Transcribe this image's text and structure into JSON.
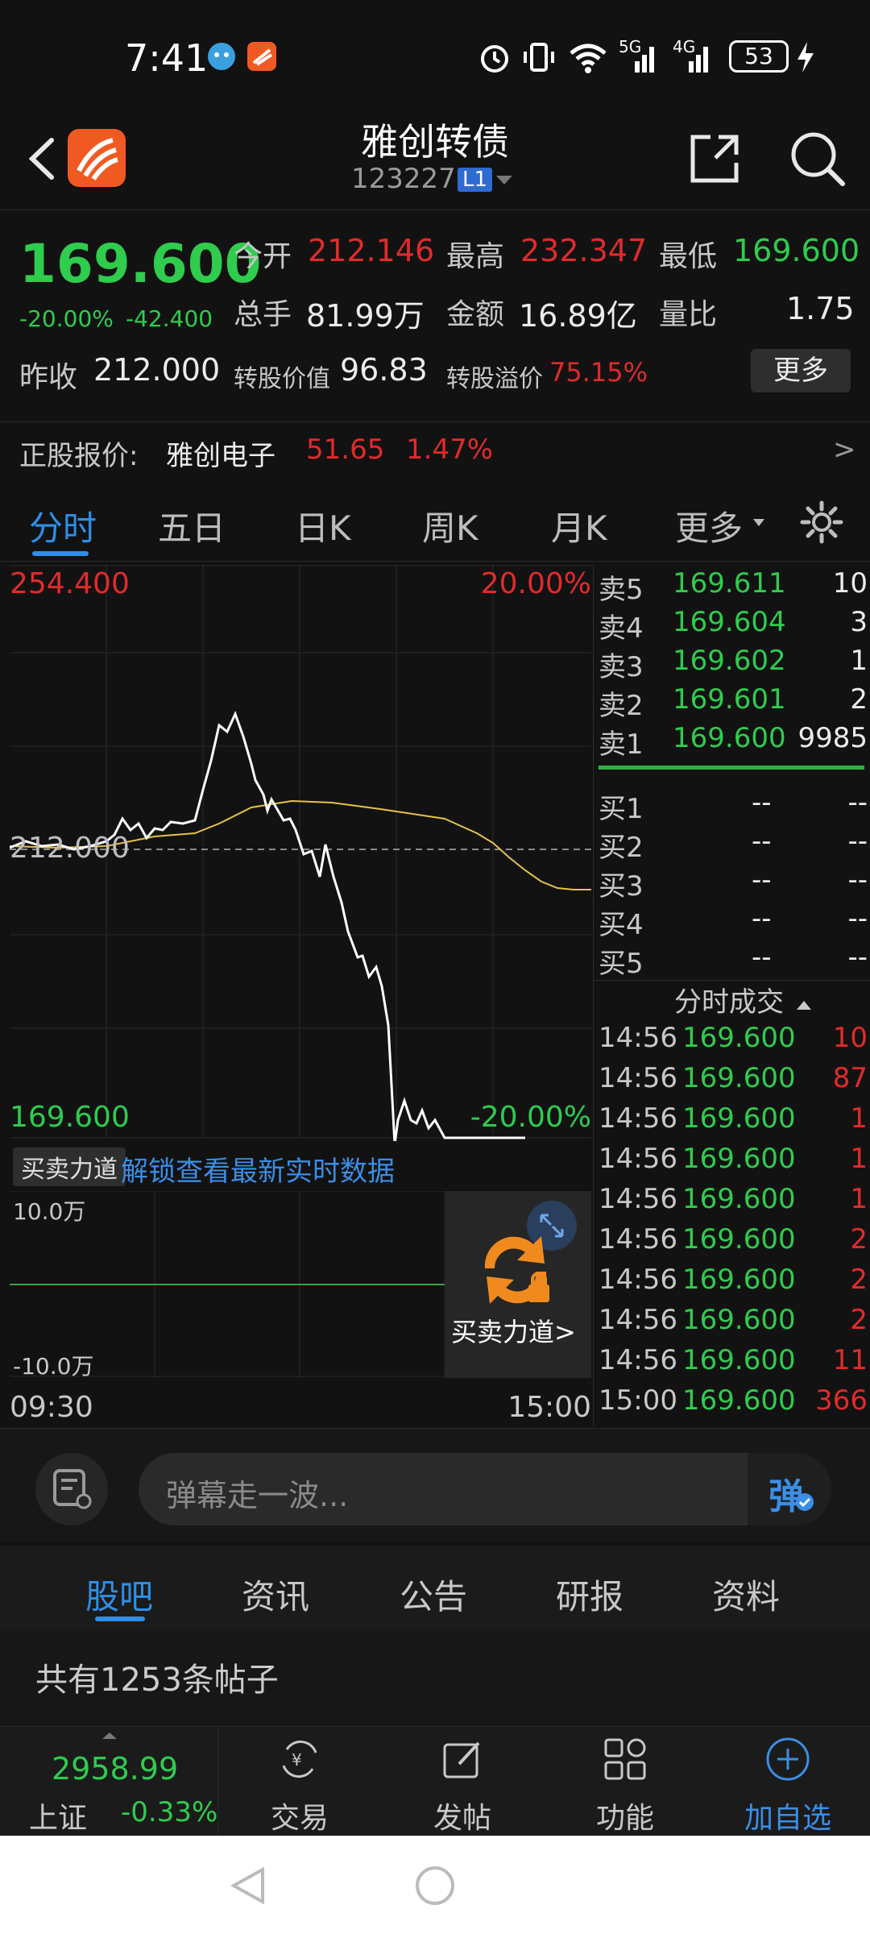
{
  "status_bar": {
    "time": "7:41",
    "battery": "53",
    "network1": "5G",
    "network2": "4G"
  },
  "header": {
    "title": "雅创转债",
    "code": "123227",
    "level_badge": "L1"
  },
  "quote": {
    "price": "169.600",
    "change_pct": "-20.00%",
    "change_amt": "-42.400",
    "open_label": "今开",
    "open_value": "212.146",
    "high_label": "最高",
    "high_value": "232.347",
    "low_label": "最低",
    "low_value": "169.600",
    "volume_label": "总手",
    "volume_value": "81.99万",
    "amount_label": "金额",
    "amount_value": "16.89亿",
    "ratio_label": "量比",
    "ratio_value": "1.75",
    "prev_close_label": "昨收",
    "prev_close_value": "212.000",
    "conv_value_label": "转股价值",
    "conv_value": "96.83",
    "premium_label": "转股溢价",
    "premium_value": "75.15%",
    "more_button": "更多",
    "stock_label": "正股报价:",
    "stock_name": "雅创电子",
    "stock_price": "51.65",
    "stock_change": "1.47%",
    "stock_arrow": ">"
  },
  "chart_tabs": [
    "分时",
    "五日",
    "日K",
    "周K",
    "月K",
    "更多"
  ],
  "intraday_chart": {
    "top_price": "254.400",
    "top_pct": "20.00%",
    "prev_close_label": "212.000",
    "bottom_price": "169.600",
    "bottom_pct": "-20.00%",
    "start_time": "09:30",
    "end_time": "15:00"
  },
  "order_book": {
    "asks": [
      {
        "label": "卖5",
        "price": "169.611",
        "vol": "10"
      },
      {
        "label": "卖4",
        "price": "169.604",
        "vol": "3"
      },
      {
        "label": "卖3",
        "price": "169.602",
        "vol": "1"
      },
      {
        "label": "卖2",
        "price": "169.601",
        "vol": "2"
      },
      {
        "label": "卖1",
        "price": "169.600",
        "vol": "9985"
      }
    ],
    "bids": [
      {
        "label": "买1",
        "price": "--",
        "vol": "--"
      },
      {
        "label": "买2",
        "price": "--",
        "vol": "--"
      },
      {
        "label": "买3",
        "price": "--",
        "vol": "--"
      },
      {
        "label": "买4",
        "price": "--",
        "vol": "--"
      },
      {
        "label": "买5",
        "price": "--",
        "vol": "--"
      }
    ],
    "ticks_title": "分时成交",
    "ticks": [
      {
        "time": "14:56",
        "price": "169.600",
        "vol": "10"
      },
      {
        "time": "14:56",
        "price": "169.600",
        "vol": "87"
      },
      {
        "time": "14:56",
        "price": "169.600",
        "vol": "1"
      },
      {
        "time": "14:56",
        "price": "169.600",
        "vol": "1"
      },
      {
        "time": "14:56",
        "price": "169.600",
        "vol": "1"
      },
      {
        "time": "14:56",
        "price": "169.600",
        "vol": "2"
      },
      {
        "time": "14:56",
        "price": "169.600",
        "vol": "2"
      },
      {
        "time": "14:56",
        "price": "169.600",
        "vol": "2"
      },
      {
        "time": "14:56",
        "price": "169.600",
        "vol": "11"
      },
      {
        "time": "15:00",
        "price": "169.600",
        "vol": "366"
      }
    ]
  },
  "power": {
    "tag": "买卖力道",
    "unlock_link": "解锁查看最新实时数据",
    "top_label": "10.0万",
    "bottom_label": "-10.0万",
    "overlay_label": "买卖力道>"
  },
  "comment": {
    "placeholder": "弹幕走一波...",
    "danmu": "弹"
  },
  "section_tabs": [
    "股吧",
    "资讯",
    "公告",
    "研报",
    "资料"
  ],
  "posts_count_text": "共有1253条帖子",
  "toolbar": {
    "index_value": "2958.99",
    "index_name": "上证",
    "index_change": "-0.33%",
    "trade": "交易",
    "post": "发帖",
    "functions": "功能",
    "add_watch": "加自选"
  }
}
